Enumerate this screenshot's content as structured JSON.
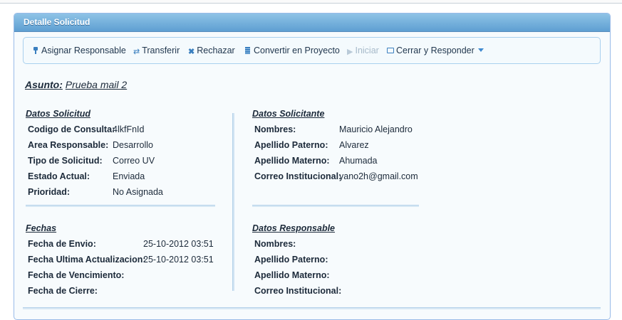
{
  "panel": {
    "title": "Detalle Solicitud"
  },
  "toolbar": {
    "items": [
      {
        "label": "Asignar Responsable",
        "icon": "pin-icon"
      },
      {
        "label": "Transferir",
        "icon": "transfer-icon"
      },
      {
        "label": "Rechazar",
        "icon": "x-icon"
      },
      {
        "label": "Convertir en Proyecto",
        "icon": "document-icon"
      },
      {
        "label": "Iniciar",
        "icon": "play-icon",
        "disabled": true
      },
      {
        "label": "Cerrar y Responder",
        "icon": "mail-icon"
      }
    ]
  },
  "asunto": {
    "label": "Asunto:",
    "value": "Prueba mail 2"
  },
  "datos_solicitud": {
    "title": "Datos Solicitud",
    "rows": [
      {
        "k": "Codigo de Consulta:",
        "v": "4lkfFnId"
      },
      {
        "k": "Area Responsable:",
        "v": "Desarrollo"
      },
      {
        "k": "Tipo de Solicitud:",
        "v": "Correo UV"
      },
      {
        "k": "Estado Actual:",
        "v": "Enviada"
      },
      {
        "k": "Prioridad:",
        "v": "No Asignada"
      }
    ]
  },
  "datos_solicitante": {
    "title": "Datos Solicitante",
    "rows": [
      {
        "k": "Nombres:",
        "v": "Mauricio Alejandro"
      },
      {
        "k": "Apellido Paterno:",
        "v": "Alvarez"
      },
      {
        "k": "Apellido Materno:",
        "v": "Ahumada"
      },
      {
        "k": "Correo Institucional:",
        "v": "yano2h@gmail.com"
      }
    ]
  },
  "fechas": {
    "title": "Fechas",
    "rows": [
      {
        "k": "Fecha de Envio:",
        "v": "25-10-2012 03:51"
      },
      {
        "k": "Fecha Ultima Actualizacion:",
        "v": "25-10-2012 03:51"
      },
      {
        "k": "Fecha de Vencimiento:",
        "v": ""
      },
      {
        "k": "Fecha de Cierre:",
        "v": ""
      }
    ]
  },
  "datos_responsable": {
    "title": "Datos Responsable",
    "rows": [
      {
        "k": "Nombres:",
        "v": ""
      },
      {
        "k": "Apellido Paterno:",
        "v": ""
      },
      {
        "k": "Apellido Materno:",
        "v": ""
      },
      {
        "k": "Correo Institucional:",
        "v": ""
      }
    ]
  }
}
